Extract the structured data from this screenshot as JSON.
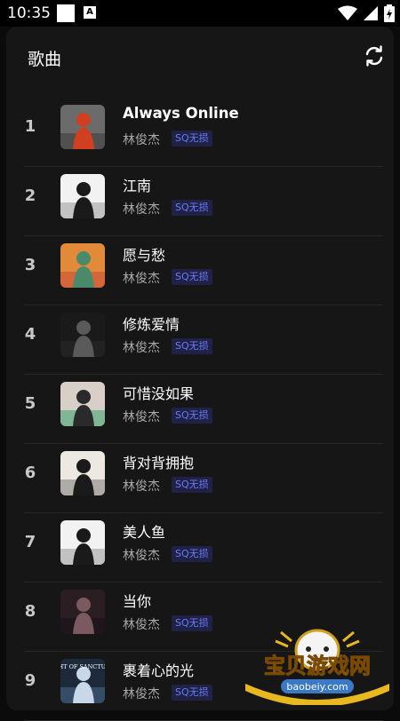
{
  "status_bar": {
    "time": "10:35"
  },
  "header": {
    "title": "歌曲",
    "refresh_icon": "refresh-icon"
  },
  "songs": [
    {
      "rank": "1",
      "title": "Always Online",
      "artist": "林俊杰",
      "badge": "SQ无损",
      "cover_colors": [
        "#6b6b6b",
        "#d04020",
        "#3a3a3a"
      ]
    },
    {
      "rank": "2",
      "title": "江南",
      "artist": "林俊杰",
      "badge": "SQ无损",
      "cover_colors": [
        "#f2f2f2",
        "#1a1a1a",
        "#9a9a9a"
      ]
    },
    {
      "rank": "3",
      "title": "愿与愁",
      "artist": "林俊杰",
      "badge": "SQ无损",
      "cover_colors": [
        "#e08a3a",
        "#4a8a6a",
        "#c84a3a"
      ]
    },
    {
      "rank": "4",
      "title": "修炼爱情",
      "artist": "林俊杰",
      "badge": "SQ无损",
      "cover_colors": [
        "#1a1a1a",
        "#5a5a5a",
        "#2a2a2a"
      ]
    },
    {
      "rank": "5",
      "title": "可惜没如果",
      "artist": "林俊杰",
      "badge": "SQ无损",
      "cover_colors": [
        "#d8d0c8",
        "#2a2a2a",
        "#3aa06a"
      ]
    },
    {
      "rank": "6",
      "title": "背对背拥抱",
      "artist": "林俊杰",
      "badge": "SQ无损",
      "cover_colors": [
        "#ece8e2",
        "#1a1a1a",
        "#7a7a7a"
      ]
    },
    {
      "rank": "7",
      "title": "美人鱼",
      "artist": "林俊杰",
      "badge": "SQ无损",
      "cover_colors": [
        "#f2f2f2",
        "#1a1a1a",
        "#9a9a9a"
      ]
    },
    {
      "rank": "8",
      "title": "当你",
      "artist": "林俊杰",
      "badge": "SQ无损",
      "cover_colors": [
        "#2a1e22",
        "#7a5a60",
        "#141014"
      ]
    },
    {
      "rank": "9",
      "title": "裹着心的光",
      "artist": "林俊杰",
      "badge": "SQ无损",
      "cover_colors": [
        "#1c2a3a",
        "#c8d8e8",
        "#4a6a8a"
      ],
      "cover_text": "LIGHT OF SANCTUARY"
    }
  ],
  "watermark": {
    "title": "宝贝游戏网",
    "url": "baobeiy.com"
  },
  "colors": {
    "background": "#0b0b0b",
    "card": "#161616",
    "badge_text": "#6b7cf3",
    "badge_bg": "#1f2147"
  }
}
